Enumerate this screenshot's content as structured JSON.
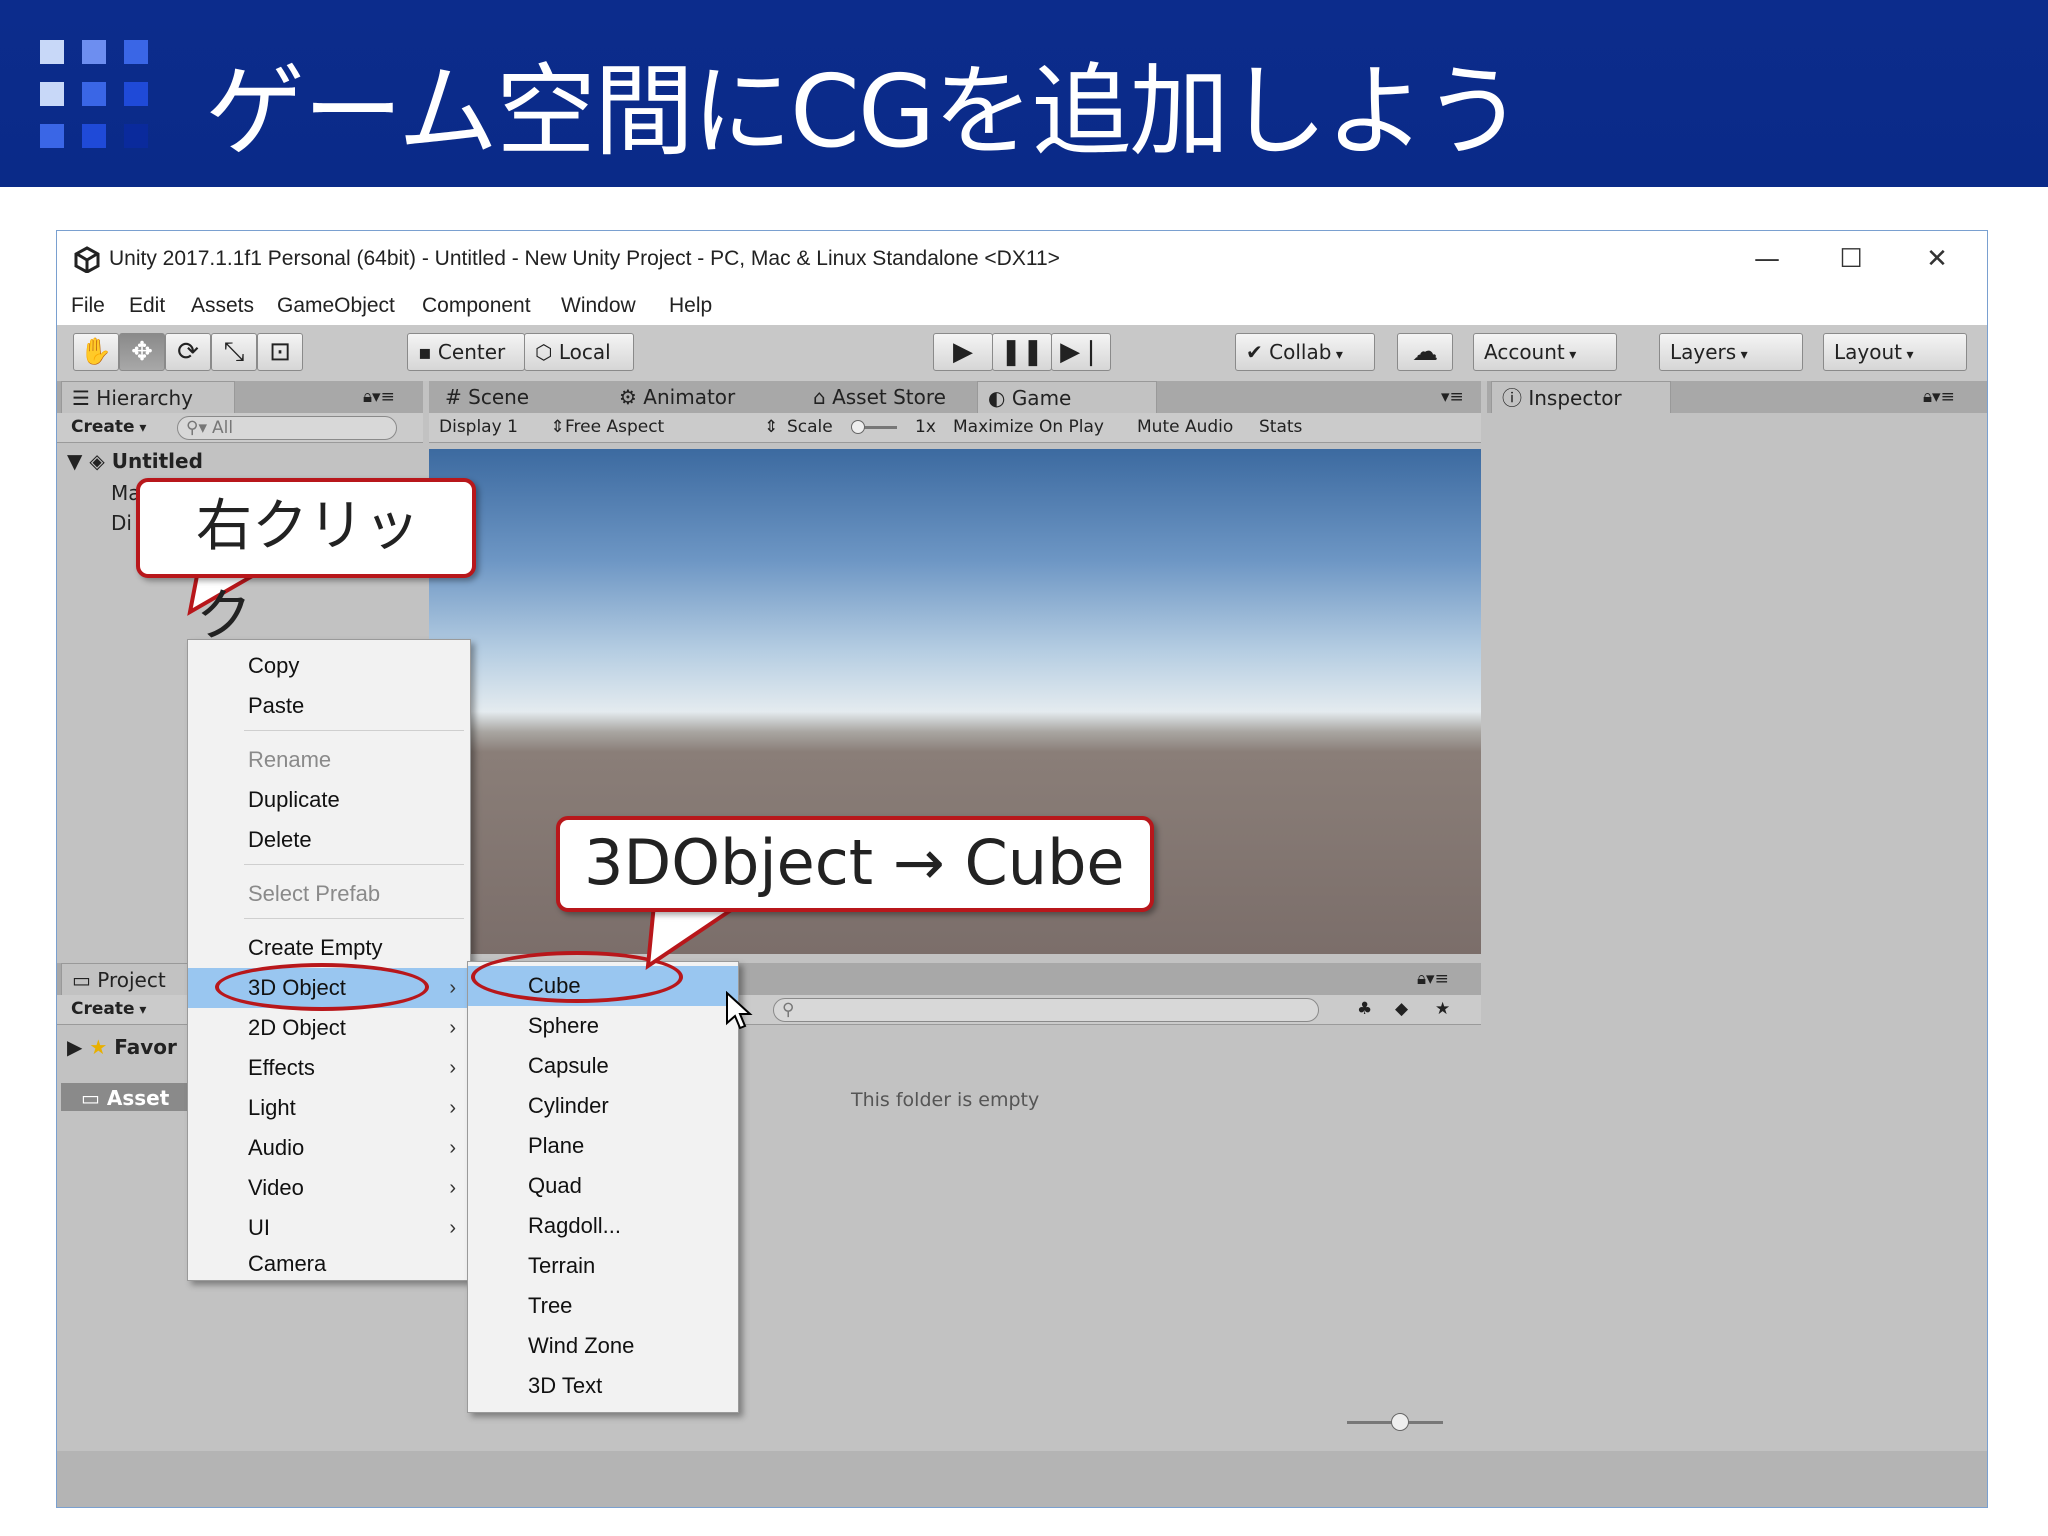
{
  "slide": {
    "title": "ゲーム空間にCGを追加しよう"
  },
  "window": {
    "title": "Unity 2017.1.1f1 Personal (64bit) - Untitled - New Unity Project - PC, Mac & Linux Standalone <DX11>",
    "minimize": "—",
    "maximize": "☐",
    "close": "✕"
  },
  "menu": [
    "File",
    "Edit",
    "Assets",
    "GameObject",
    "Component",
    "Window",
    "Help"
  ],
  "toolbar": {
    "center": "Center",
    "local": "Local",
    "collab": "Collab",
    "account": "Account",
    "layers": "Layers",
    "layout": "Layout"
  },
  "hierarchy": {
    "tab": "Hierarchy",
    "create": "Create",
    "search_placeholder": "All",
    "scene": "Untitled",
    "item1": "Ma",
    "item2": "Di"
  },
  "center_tabs": {
    "scene": "Scene",
    "animator": "Animator",
    "asset_store": "Asset Store",
    "game": "Game"
  },
  "game_bar": {
    "display": "Display 1",
    "aspect": "Free Aspect",
    "scale": "Scale",
    "scale_value": "1x",
    "maximize": "Maximize On Play",
    "mute": "Mute Audio",
    "stats": "Stats"
  },
  "inspector": {
    "tab": "Inspector"
  },
  "project": {
    "tab": "Project",
    "create": "Create",
    "favorites": "Favor",
    "assets": "Asset",
    "empty_message": "This folder is empty"
  },
  "context_menu": {
    "items": [
      "Copy",
      "Paste",
      "Rename",
      "Duplicate",
      "Delete",
      "Select Prefab",
      "Create Empty",
      "3D Object",
      "2D Object",
      "Effects",
      "Light",
      "Audio",
      "Video",
      "UI",
      "Camera"
    ]
  },
  "submenu": {
    "items": [
      "Cube",
      "Sphere",
      "Capsule",
      "Cylinder",
      "Plane",
      "Quad",
      "Ragdoll...",
      "Terrain",
      "Tree",
      "Wind Zone",
      "3D Text"
    ]
  },
  "callouts": {
    "right_click": "右クリック",
    "path": "3DObject → Cube"
  },
  "colors": {
    "banner": "#0a2a88",
    "callout_border": "#b8171b",
    "menu_highlight": "#99c6f0"
  }
}
